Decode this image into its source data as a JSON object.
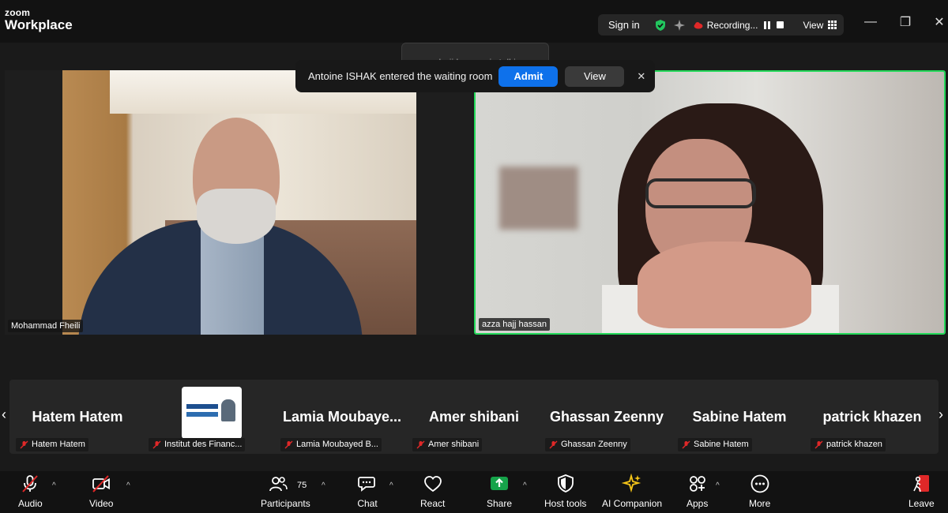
{
  "app": {
    "brand_top": "zoom",
    "brand_bottom": "Workplace"
  },
  "titlebar": {
    "sign_in": "Sign in",
    "recording": "Recording...",
    "view": "View",
    "minimize": "—",
    "restore": "❐",
    "close": "✕"
  },
  "tooltip": {
    "talking": "azza hajj hassan is talking..."
  },
  "notification": {
    "message": "Antoine ISHAK entered the waiting room",
    "admit": "Admit",
    "view": "View",
    "close": "✕"
  },
  "videos": [
    {
      "name": "Mohammad Fheili"
    },
    {
      "name": "azza hajj hassan"
    }
  ],
  "filmstrip": {
    "prev": "‹",
    "next": "›",
    "participants": [
      {
        "display": "Hatem Hatem",
        "label": "Hatem Hatem"
      },
      {
        "display": "",
        "label": "Institut des Financ..."
      },
      {
        "display": "Lamia  Moubaye...",
        "label": "Lamia Moubayed B..."
      },
      {
        "display": "Amer shibani",
        "label": "Amer shibani"
      },
      {
        "display": "Ghassan Zeenny",
        "label": "Ghassan Zeenny"
      },
      {
        "display": "Sabine Hatem",
        "label": "Sabine Hatem"
      },
      {
        "display": "patrick khazen",
        "label": "patrick khazen"
      }
    ]
  },
  "toolbar": {
    "audio": "Audio",
    "video": "Video",
    "participants": "Participants",
    "participants_count": "75",
    "chat": "Chat",
    "react": "React",
    "share": "Share",
    "host_tools": "Host tools",
    "ai_companion": "AI Companion",
    "apps": "Apps",
    "more": "More",
    "leave": "Leave",
    "caret": "^"
  },
  "colors": {
    "accent_blue": "#0e71eb",
    "active_speaker": "#23d959",
    "share_green": "#16a34a",
    "muted_red": "#e02828",
    "leave_red": "#e02828"
  }
}
